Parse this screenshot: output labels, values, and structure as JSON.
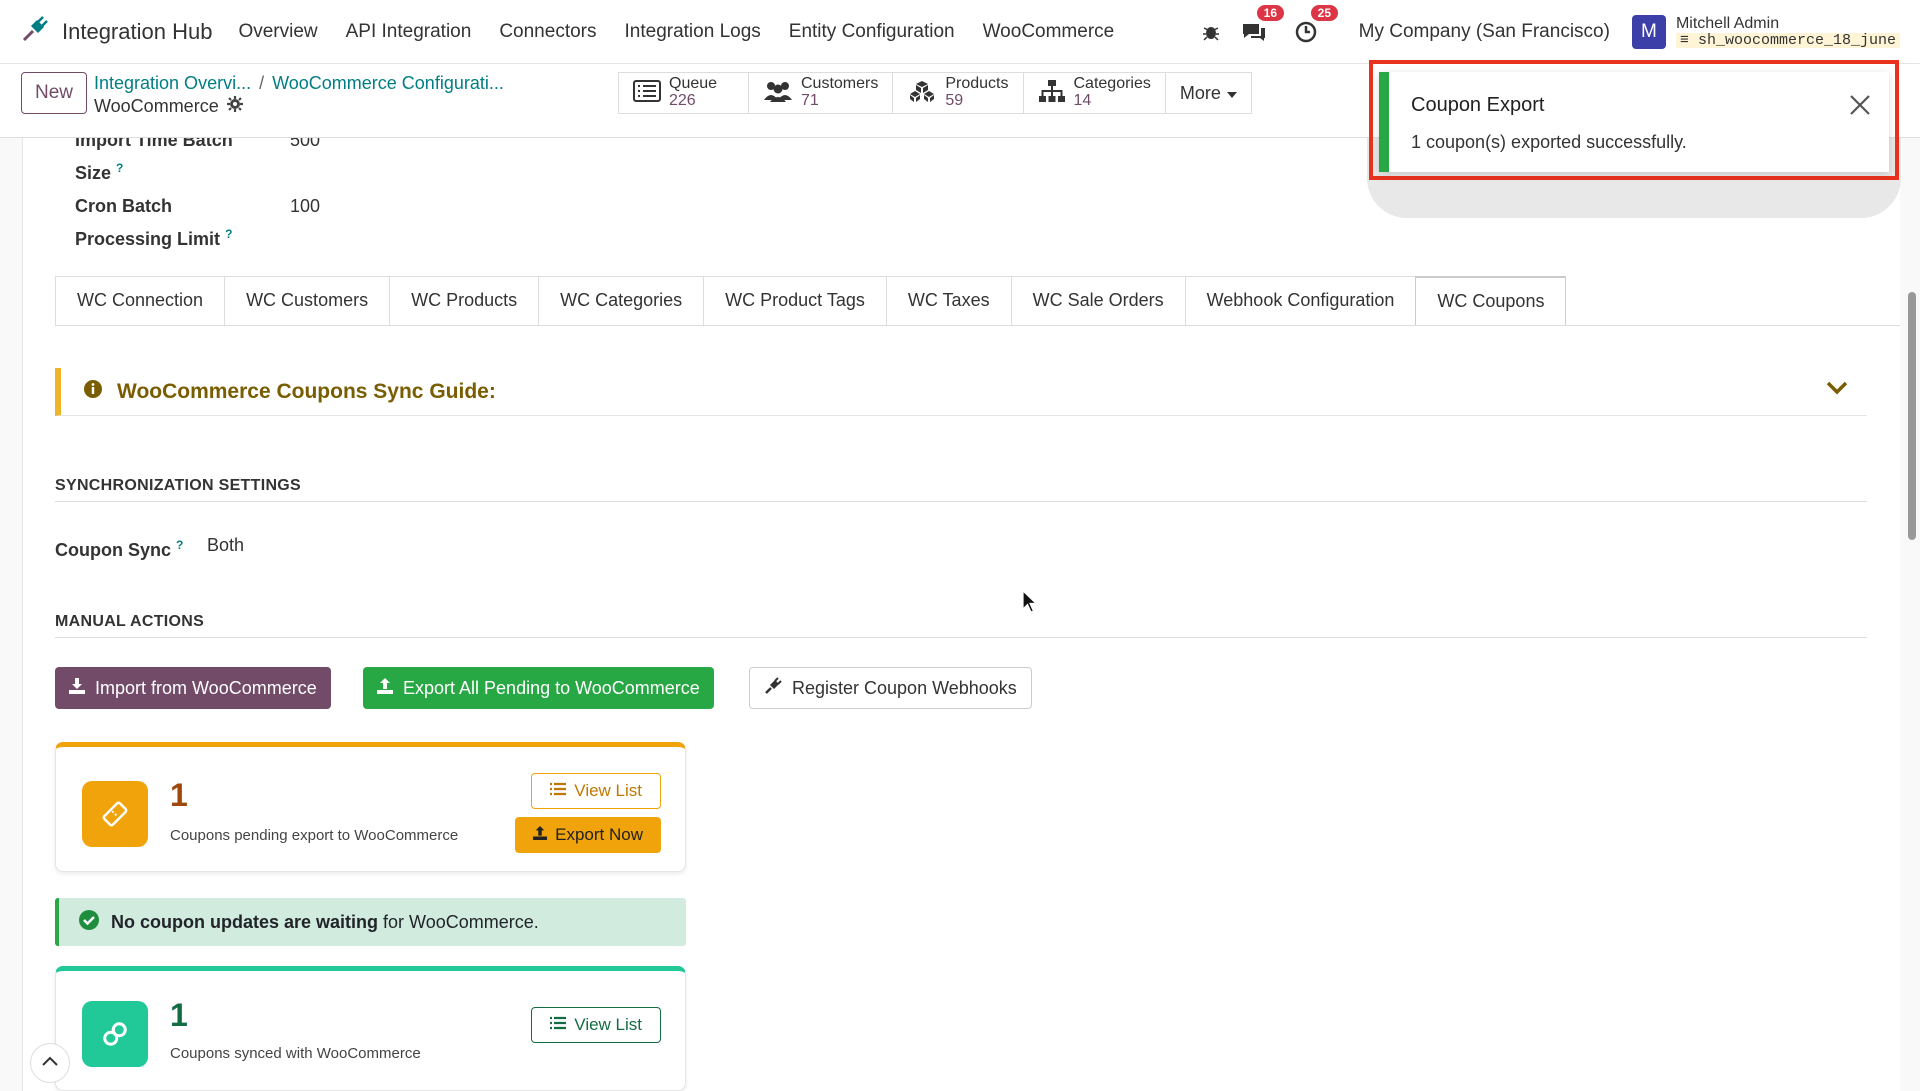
{
  "navbar": {
    "app_title": "Integration Hub",
    "menu": [
      "Overview",
      "API Integration",
      "Connectors",
      "Integration Logs",
      "Entity Configuration",
      "WooCommerce"
    ],
    "messages_badge": "16",
    "activities_badge": "25",
    "company": "My Company (San Francisco)",
    "avatar_letter": "M",
    "user_name": "Mitchell Admin",
    "db_name": "sh_woocommerce_18_june"
  },
  "control": {
    "new_label": "New",
    "breadcrumb_parent": "Integration Overvi...",
    "breadcrumb_child": "WooCommerce Configurati...",
    "current_record": "WooCommerce",
    "smart_buttons": [
      {
        "label": "Queue",
        "value": "226"
      },
      {
        "label": "Customers",
        "value": "71"
      },
      {
        "label": "Products",
        "value": "59"
      },
      {
        "label": "Categories",
        "value": "14"
      }
    ],
    "more_label": "More"
  },
  "fields": {
    "batch_label_line": "Size",
    "batch_label_partial": "Import Time Batch",
    "batch_value_partial": "500",
    "cron_label_1": "Cron Batch",
    "cron_label_2": "Processing Limit",
    "cron_value": "100"
  },
  "tabs": [
    "WC Connection",
    "WC Customers",
    "WC Products",
    "WC Categories",
    "WC Product Tags",
    "WC Taxes",
    "WC Sale Orders",
    "Webhook Configuration",
    "WC Coupons"
  ],
  "active_tab": "WC Coupons",
  "guide": {
    "title": "WooCommerce Coupons Sync Guide:"
  },
  "sync_section": {
    "title": "SYNCHRONIZATION SETTINGS",
    "coupon_sync_label": "Coupon Sync",
    "coupon_sync_value": "Both"
  },
  "manual_section": {
    "title": "MANUAL ACTIONS",
    "import_label": "Import from WooCommerce",
    "export_all_label": "Export All Pending to WooCommerce",
    "register_label": "Register Coupon Webhooks"
  },
  "pending_card": {
    "count": "1",
    "description": "Coupons pending export to WooCommerce",
    "view_list": "View List",
    "export_now": "Export Now"
  },
  "alert": {
    "bold": "No coupon updates are waiting",
    "rest": "for WooCommerce."
  },
  "synced_card": {
    "count": "1",
    "description": "Coupons synced with WooCommerce",
    "view_list": "View List"
  },
  "toast": {
    "title": "Coupon Export",
    "message": "1 coupon(s) exported successfully."
  },
  "colors": {
    "primary": "#714b67",
    "success": "#28a745",
    "warning": "#f0a30a",
    "teal": "#20c997",
    "highlight_box": "#e8321e"
  }
}
